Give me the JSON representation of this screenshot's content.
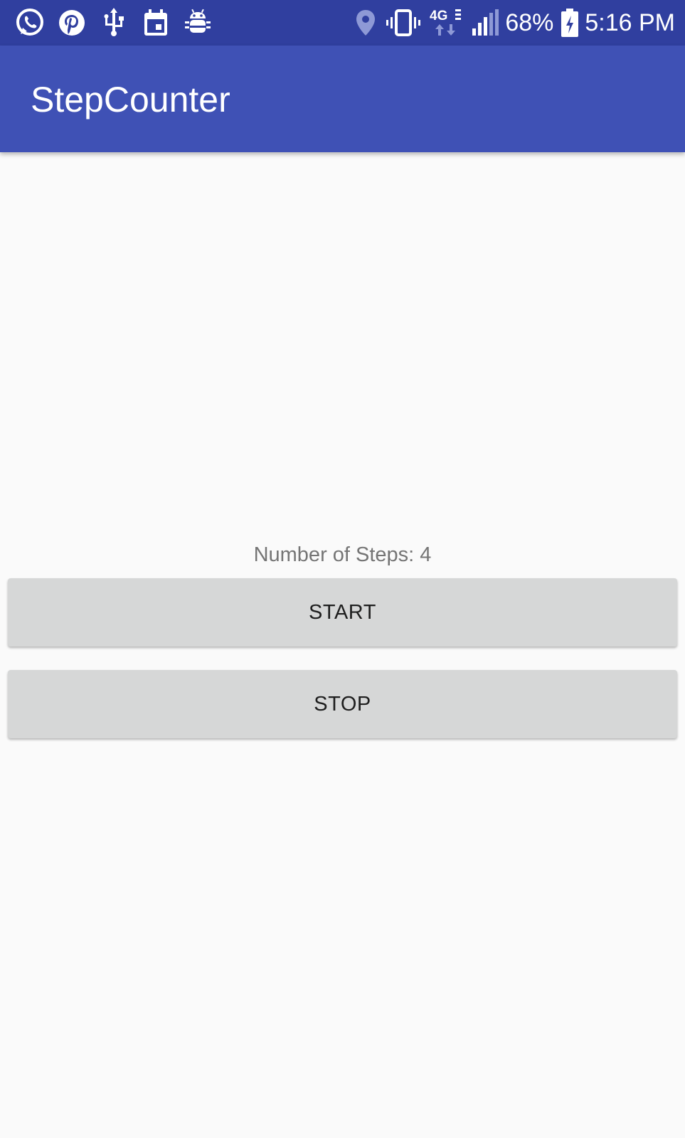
{
  "status_bar": {
    "left_icons": [
      "whatsapp-icon",
      "pinterest-icon",
      "usb-icon",
      "calendar-icon",
      "android-debug-icon"
    ],
    "right_icons": [
      "location-icon",
      "vibrate-icon",
      "4g-lte-icon",
      "signal-icon",
      "battery-charging-icon"
    ],
    "network_label": "4G",
    "battery_percent": "68%",
    "time": "5:16 PM"
  },
  "app_bar": {
    "title": "StepCounter"
  },
  "main": {
    "steps_text": "Number of Steps: 4",
    "start_label": "START",
    "stop_label": "STOP"
  },
  "colors": {
    "status_bar": "#303f9f",
    "app_bar": "#3f51b5",
    "background": "#fafafa",
    "button": "#d6d7d7",
    "label_text": "#757575"
  }
}
